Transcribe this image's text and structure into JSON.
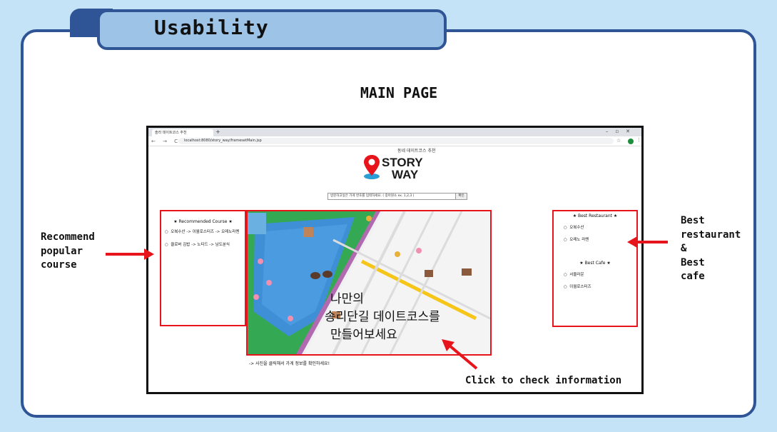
{
  "slide": {
    "tab_title": "Usability",
    "main_title": "MAIN PAGE"
  },
  "browser": {
    "tab_label": "솔라 데이트코스 추천",
    "new_tab": "+",
    "window_controls": "–▫✕",
    "nav_buttons": "← → C ⓘ",
    "url": "localhost:8080/story_way/framesetMain.jsp",
    "star_icon": "star-icon"
  },
  "site": {
    "logo_sub": "동네 데이트코스 추천",
    "logo_line1": "STORY",
    "logo_line2": "WAY",
    "search_placeholder": "방문하고싶은 가게 번호를 입력하세요. ( 중아원소 ex. 1,2,3 )",
    "search_button": "확인",
    "course": {
      "heading": "★ Recommended Course ★",
      "items": [
        "오복수산 -> 이월로스터즈 -> 오레노라멘",
        "클로버 김밥 -> 노티드 -> 남도분식"
      ]
    },
    "best": {
      "restaurant_heading": "★ Best Restaurant ★",
      "restaurants": [
        "오복수산",
        "오레노 라멘"
      ],
      "cafe_heading": "★ Best Cafe ★",
      "cafes": [
        "서울라운",
        "이월로스터즈"
      ]
    },
    "map": {
      "line1": "나만의",
      "line2": "송리단길 데이트코스를",
      "line3": "만들어보세요"
    },
    "caption": "-> 사진을 클릭해서 가게 정보를 확인하세요!"
  },
  "annotations": {
    "left": [
      "Recommend",
      "popular",
      "course"
    ],
    "right": [
      "Best",
      "restaurant",
      "&",
      "Best",
      "cafe"
    ],
    "bottom": "Click to check information"
  },
  "colors": {
    "slide_bg": "#c5e3f6",
    "frame": "#2f5597",
    "tab_fill": "#9dc3e6",
    "highlight_red": "#e8141c"
  }
}
